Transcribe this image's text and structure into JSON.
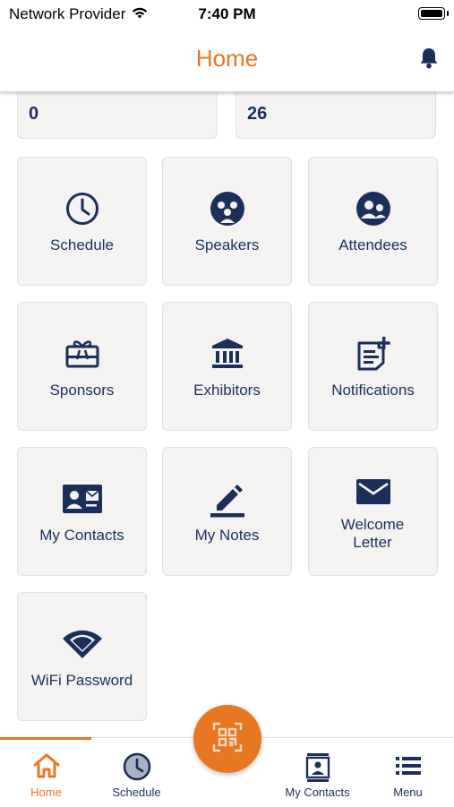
{
  "status_bar": {
    "carrier": "Network Provider",
    "time": "7:40 PM"
  },
  "header": {
    "title": "Home"
  },
  "stats": [
    {
      "value": "0"
    },
    {
      "value": "26"
    }
  ],
  "tiles": [
    {
      "label": "Schedule",
      "icon": "clock-icon"
    },
    {
      "label": "Speakers",
      "icon": "speakers-icon"
    },
    {
      "label": "Attendees",
      "icon": "attendees-icon"
    },
    {
      "label": "Sponsors",
      "icon": "gift-card-icon"
    },
    {
      "label": "Exhibitors",
      "icon": "bank-icon"
    },
    {
      "label": "Notifications",
      "icon": "note-add-icon"
    },
    {
      "label": "My Contacts",
      "icon": "contact-card-icon"
    },
    {
      "label": "My Notes",
      "icon": "pencil-icon"
    },
    {
      "label": "Welcome Letter",
      "icon": "envelope-icon"
    },
    {
      "label": "WiFi Password",
      "icon": "wifi-icon"
    }
  ],
  "tabbar": {
    "items": [
      {
        "label": "Home",
        "icon": "home-icon",
        "active": true
      },
      {
        "label": "Schedule",
        "icon": "clock-icon"
      },
      {
        "label": "My Contacts",
        "icon": "contact-book-icon"
      },
      {
        "label": "Menu",
        "icon": "menu-icon"
      }
    ],
    "center_action": "qr-scan-icon"
  },
  "colors": {
    "accent": "#e87722",
    "navy": "#1b2f5b",
    "tile_bg": "#f4f3f2"
  }
}
